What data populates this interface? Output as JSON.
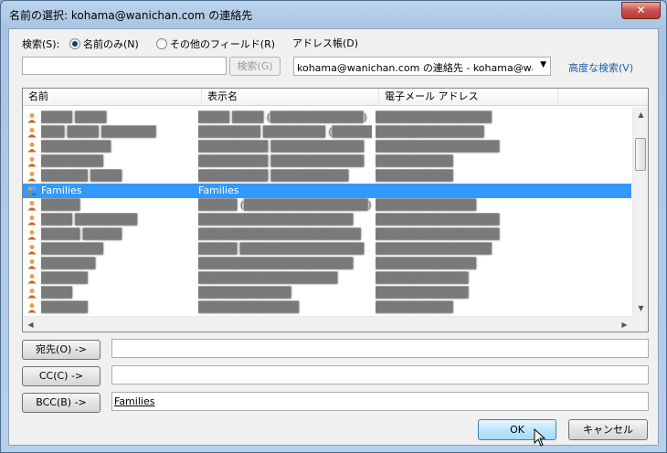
{
  "window": {
    "title": "名前の選択: kohama@wanichan.com の連絡先",
    "close_glyph": "✕"
  },
  "search": {
    "label": "検索(S):",
    "option_name_only": "名前のみ(N)",
    "option_other_fields": "その他のフィールド(R)",
    "input_value": "",
    "search_button": "検索(G)",
    "address_book_label": "アドレス帳(D)",
    "address_book_selected": "kohama@wanichan.com の連絡先 - kohama@wanic",
    "advanced_link": "高度な検索(V)"
  },
  "list": {
    "columns": [
      "名前",
      "表示名",
      "電子メール アドレス"
    ],
    "rows": [
      {
        "name": "████ ████",
        "display": "████ ████ (████████████)",
        "email": "███████████████",
        "selected": false,
        "group": false
      },
      {
        "name": "███ ████ ███████",
        "display": "████████ ████████ (████████)",
        "email": "██████████████",
        "selected": false,
        "group": false
      },
      {
        "name": "█████████",
        "display": "█████████ ████████████",
        "email": "████████████████",
        "selected": false,
        "group": false
      },
      {
        "name": "████████",
        "display": "█████████ ████████████",
        "email": "██████████",
        "selected": false,
        "group": false
      },
      {
        "name": "██████ ████",
        "display": "█████████ ██████████",
        "email": "██████████",
        "selected": false,
        "group": false
      },
      {
        "name": "Families",
        "display": "Families",
        "email": "",
        "selected": true,
        "group": true
      },
      {
        "name": "█████",
        "display": "█████ (████████████████)",
        "email": "█████████████",
        "selected": false,
        "group": false
      },
      {
        "name": "████ ████████",
        "display": "████████████████████",
        "email": "████████████████",
        "selected": false,
        "group": false
      },
      {
        "name": "█████ █████",
        "display": "█████████████████████",
        "email": "████████████████",
        "selected": false,
        "group": false
      },
      {
        "name": "████████",
        "display": "█████ ████████████████",
        "email": "███████████████",
        "selected": false,
        "group": false
      },
      {
        "name": "███████",
        "display": "████████████████████",
        "email": "█████████████",
        "selected": false,
        "group": false
      },
      {
        "name": "██████",
        "display": "██████████████████",
        "email": "████████████",
        "selected": false,
        "group": false
      },
      {
        "name": "████",
        "display": "████████████",
        "email": "████████████",
        "selected": false,
        "group": false
      },
      {
        "name": "██████",
        "display": "█████████████",
        "email": "██████████",
        "selected": false,
        "group": false
      }
    ]
  },
  "recipients": {
    "to_button": "宛先(O) ->",
    "to_value": "",
    "cc_button": "CC(C) ->",
    "cc_value": "",
    "bcc_button": "BCC(B) ->",
    "bcc_value": "Families"
  },
  "footer": {
    "ok_button": "OK",
    "cancel_button": "キャンセル"
  },
  "colors": {
    "selection": "#3399ff",
    "link": "#1c5dab",
    "close_button": "#c75050"
  }
}
